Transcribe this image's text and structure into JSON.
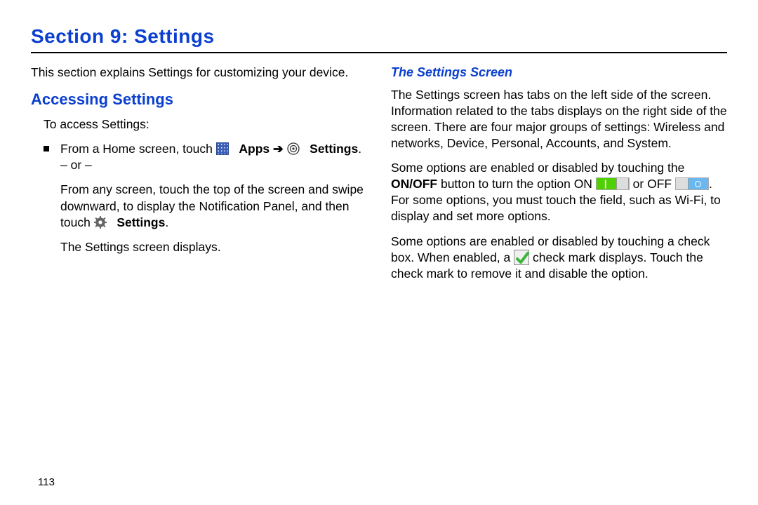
{
  "section_title": "Section 9: Settings",
  "left": {
    "intro": "This section explains Settings for customizing your device.",
    "h2": "Accessing Settings",
    "lead": "To access Settings:",
    "step1_pre": "From a Home screen, touch ",
    "apps_label": "Apps",
    "arrow": " ➔ ",
    "settings_label": "Settings",
    "period": ".",
    "or_line": "– or –",
    "step2a": "From any screen, touch the top of the screen and swipe downward, to display the Notification Panel, and then touch ",
    "settings_label2": "Settings",
    "step2b": ".",
    "result": "The Settings screen displays."
  },
  "right": {
    "h3": "The Settings Screen",
    "p1": "The Settings screen has tabs on the left side of the screen. Information related to the tabs displays on the right side of the screen. There are four major groups of settings: Wireless and networks, Device, Personal, Accounts, and System.",
    "p2a": "Some options are enabled or disabled by touching the ",
    "onoff": "ON/OFF",
    "p2b": " button to turn the option ON ",
    "p2c": " or OFF ",
    "p2d": ". For some options, you must touch the field, such as Wi-Fi, to display and set more options.",
    "p3a": "Some options are enabled or disabled by touching a check box. When enabled, a ",
    "p3b": " check mark displays. Touch the check mark to remove it and disable the option."
  },
  "page_num": "113"
}
